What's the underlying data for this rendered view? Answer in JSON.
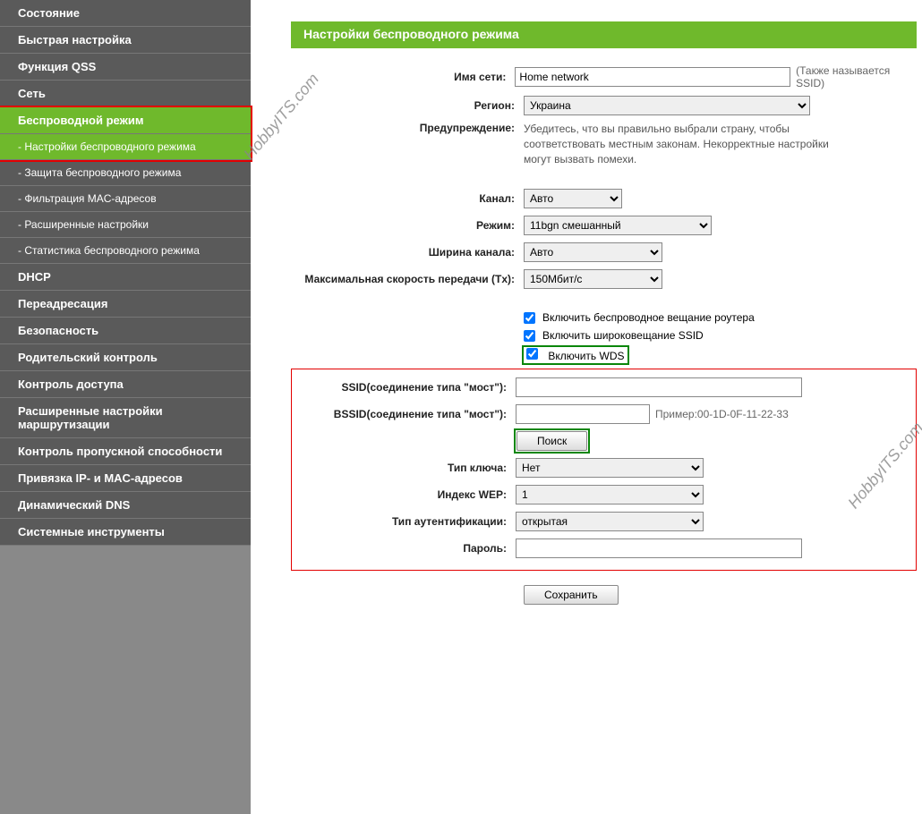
{
  "sidebar": {
    "items": [
      "Состояние",
      "Быстрая настройка",
      "Функция QSS",
      "Сеть",
      "Беспроводной режим",
      "DHCP",
      "Переадресация",
      "Безопасность",
      "Родительский контроль",
      "Контроль доступа",
      "Расширенные настройки маршрутизации",
      "Контроль пропускной способности",
      "Привязка IP- и MAC-адресов",
      "Динамический DNS",
      "Системные инструменты"
    ],
    "sub": [
      "- Настройки беспроводного режима",
      "- Защита беспроводного режима",
      "- Фильтрация MAC-адресов",
      "- Расширенные настройки",
      "- Статистика беспроводного режима"
    ]
  },
  "panel": {
    "title": "Настройки беспроводного режима"
  },
  "labels": {
    "ssid": "Имя сети:",
    "region": "Регион:",
    "warn": "Предупреждение:",
    "channel": "Канал:",
    "mode": "Режим:",
    "width": "Ширина канала:",
    "txrate": "Максимальная скорость передачи (Tx):",
    "bridge_ssid": "SSID(соединение типа \"мост\"):",
    "bridge_bssid": "BSSID(соединение типа \"мост\"):",
    "keytype": "Тип ключа:",
    "wepindex": "Индекс WEP:",
    "authtype": "Тип аутентификации:",
    "password": "Пароль:"
  },
  "values": {
    "ssid": "Home network",
    "ssid_hint": "(Также называется SSID)",
    "region": "Украина",
    "warning_text": "Убедитесь, что вы правильно выбрали страну, чтобы соответствовать местным законам. Некорректные настройки могут вызвать помехи.",
    "channel": "Авто",
    "mode": "11bgn смешанный",
    "width": "Авто",
    "txrate": "150Мбит/с",
    "chk1": "Включить беспроводное вещание роутера",
    "chk2": "Включить широковещание SSID",
    "chk3": "Включить WDS",
    "bssid_hint": "Пример:00-1D-0F-11-22-33",
    "search": "Поиск",
    "keytype": "Нет",
    "wepindex": "1",
    "authtype": "открытая",
    "save": "Сохранить"
  },
  "watermark": "HobbyITS.com"
}
